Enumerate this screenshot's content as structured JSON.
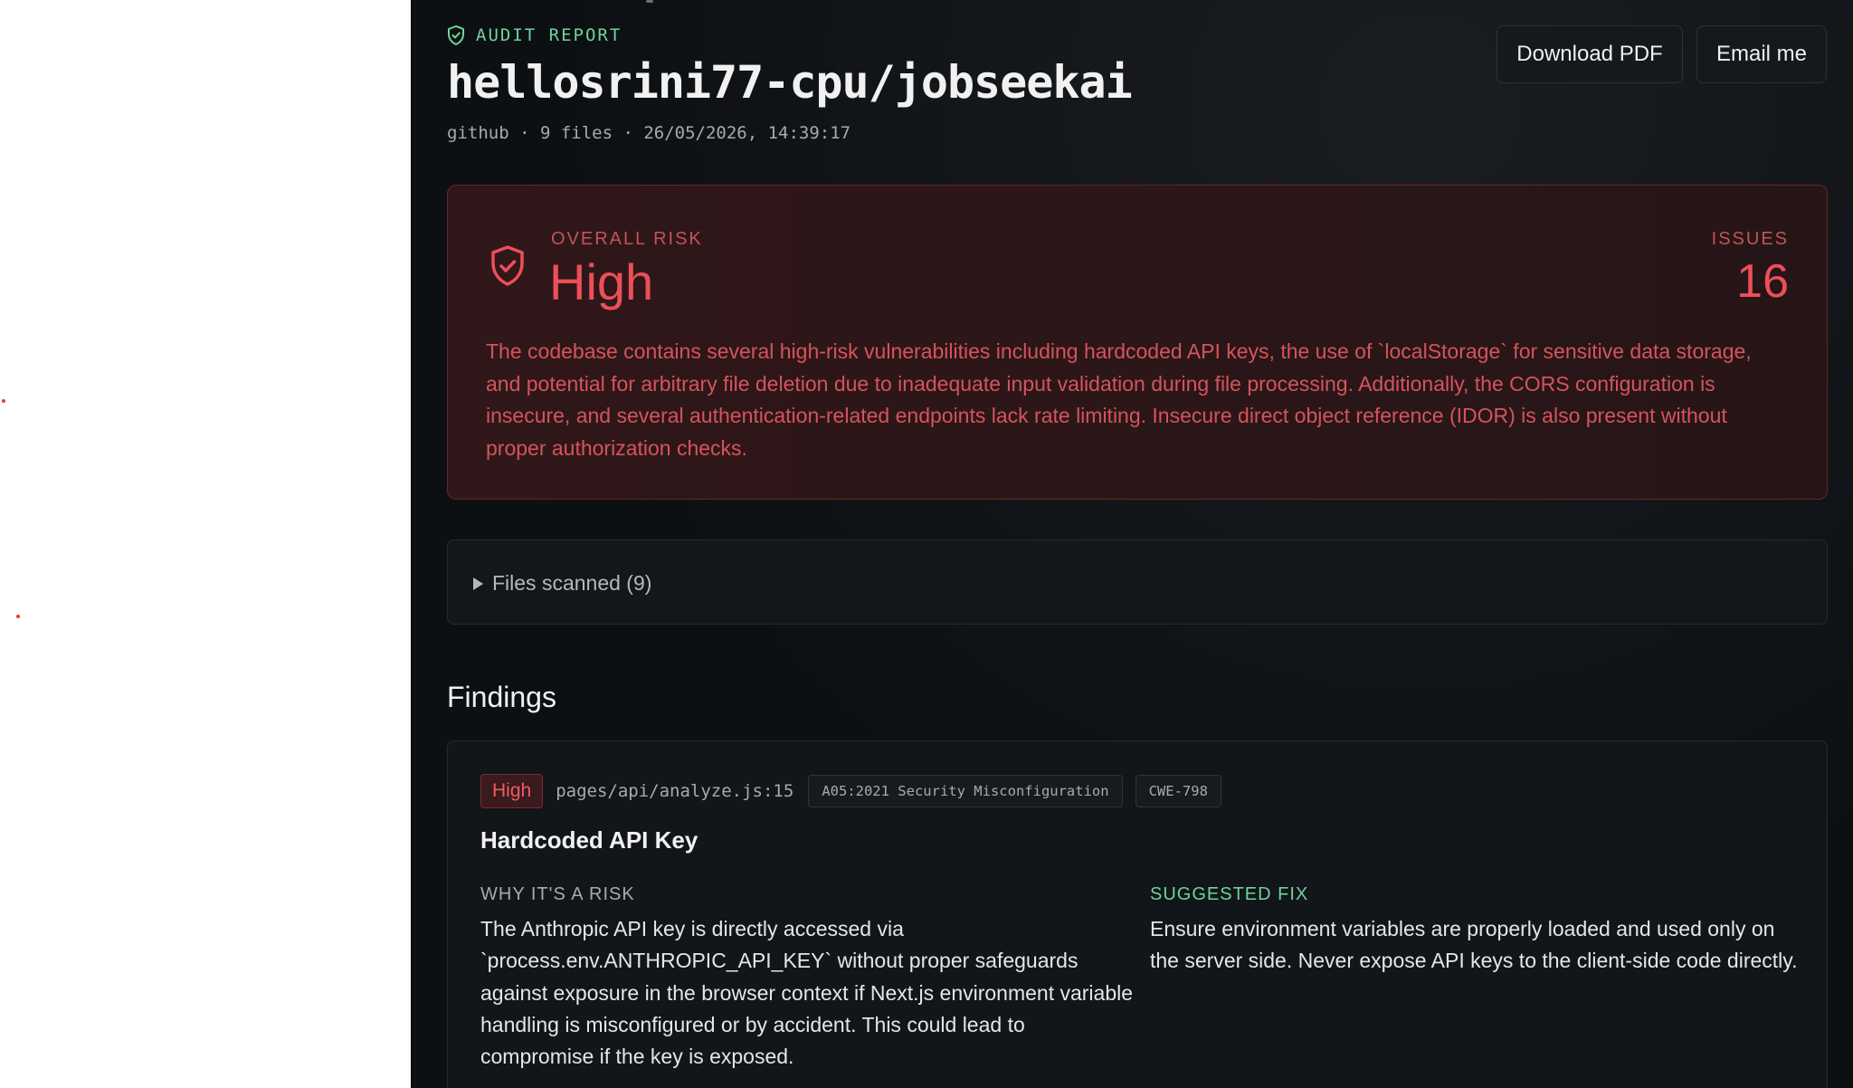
{
  "header": {
    "eyebrow": "AUDIT REPORT",
    "title": "hellosrini77-cpu/jobseekai",
    "meta": "github · 9 files · 26/05/2026, 14:39:17",
    "actions": {
      "download_label": "Download PDF",
      "email_label": "Email me"
    }
  },
  "risk": {
    "label": "OVERALL RISK",
    "level": "High",
    "issues_label": "ISSUES",
    "issues_count": "16",
    "summary": "The codebase contains several high-risk vulnerabilities including hardcoded API keys, the use of `localStorage` for sensitive data storage, and potential for arbitrary file deletion due to inadequate input validation during file processing. Additionally, the CORS configuration is insecure, and several authentication-related endpoints lack rate limiting. Insecure direct object reference (IDOR) is also present without proper authorization checks."
  },
  "files": {
    "label": "Files scanned (9)"
  },
  "findings": {
    "heading": "Findings",
    "items": [
      {
        "severity": "High",
        "location": "pages/api/analyze.js:15",
        "owasp": "A05:2021 Security Misconfiguration",
        "cwe": "CWE-798",
        "title": "Hardcoded API Key",
        "why_label": "WHY IT'S A RISK",
        "why_text": "The Anthropic API key is directly accessed via `process.env.ANTHROPIC_API_KEY` without proper safeguards against exposure in the browser context if Next.js environment variable handling is misconfigured or by accident. This could lead to compromise if the key is exposed.",
        "fix_label": "SUGGESTED FIX",
        "fix_text": "Ensure environment variables are properly loaded and used only on the server side. Never expose API keys to the client-side code directly."
      }
    ]
  },
  "colors": {
    "accent_green": "#6fd39b",
    "risk_red": "#ec4f59",
    "background": "#0d1013"
  }
}
